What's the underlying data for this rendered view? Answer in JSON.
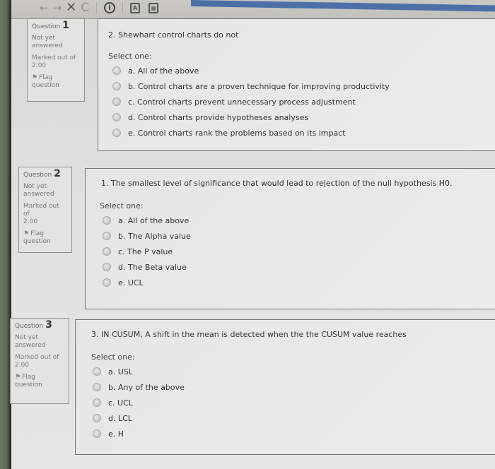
{
  "toolbar": {
    "icons": [
      "back-arrow",
      "forward-arrow",
      "close",
      "reload",
      "info",
      "pdf",
      "calculator"
    ],
    "back_glyph": "←",
    "forward_glyph": "→",
    "close_glyph": "✕",
    "reload_glyph": "C",
    "info_glyph": "i",
    "pdf_glyph": "A",
    "calc_glyph": "▦"
  },
  "questions": [
    {
      "number_label": "Question",
      "number": "1",
      "state": "Not yet answered",
      "marked_label": "Marked out of",
      "marked_value": "2.00",
      "flag_label": "Flag question",
      "text": "2. Shewhart control charts do not",
      "prompt": "Select one:",
      "options": [
        "a. All of the above",
        "b. Control charts are a proven technique for improving productivity",
        "c. Control charts prevent unnecessary process adjustment",
        "d. Control charts provide hypotheses analyses",
        "e. Control charts rank the problems based on its impact"
      ]
    },
    {
      "number_label": "Question",
      "number": "2",
      "state": "Not yet answered",
      "marked_label": "Marked out of",
      "marked_value": "2.00",
      "flag_label": "Flag question",
      "text": "1. The smallest level of significance that would lead to rejection of the null hypothesis H0.",
      "prompt": "Select one:",
      "options": [
        "a. All of the above",
        "b. The Alpha value",
        "c. The P value",
        "d. The Beta value",
        "e. UCL"
      ]
    },
    {
      "number_label": "Question",
      "number": "3",
      "state": "Not yet answered",
      "marked_label": "Marked out of",
      "marked_value": "2.00",
      "flag_label": "Flag question",
      "text": "3. IN CUSUM, A shift in the mean is detected when the the CUSUM value reaches",
      "prompt": "Select one:",
      "options": [
        "a. USL",
        "b. Any of the above",
        "c. UCL",
        "d. LCL",
        "e. H"
      ]
    }
  ],
  "colors": {
    "accent_blue": "#4d6fa8"
  }
}
